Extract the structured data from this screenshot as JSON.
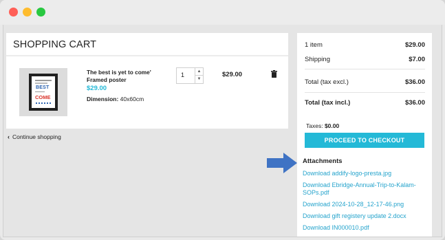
{
  "window": {
    "controls": [
      "close",
      "minimize",
      "maximize"
    ]
  },
  "cart": {
    "title": "SHOPPING CART",
    "item": {
      "name": "The best is yet to come' Framed poster",
      "price": "$29.00",
      "dimension_label": "Dimension",
      "dimension_value": "40x60cm",
      "quantity": "1",
      "line_total": "$29.00"
    },
    "continue_label": "Continue shopping"
  },
  "summary": {
    "items_label": "1 item",
    "items_value": "$29.00",
    "shipping_label": "Shipping",
    "shipping_value": "$7.00",
    "total_excl_label": "Total (tax excl.)",
    "total_excl_value": "$36.00",
    "total_incl_label": "Total (tax incl.)",
    "total_incl_value": "$36.00",
    "taxes_label": "Taxes:",
    "taxes_value": "$0.00",
    "checkout_label": "PROCEED TO CHECKOUT"
  },
  "attachments": {
    "title": "Attachments",
    "links": [
      "Download addify-logo-presta.jpg",
      "Download Ebridge-Annual-Trip-to-Kalam-SOPs.pdf",
      "Download 2024-10-28_12-17-46.png",
      "Download gift registery update 2.docx",
      "Download IN000010.pdf"
    ]
  },
  "colors": {
    "accent": "#24b9d7",
    "link": "#24a3cc",
    "arrow": "#3f73c4"
  }
}
